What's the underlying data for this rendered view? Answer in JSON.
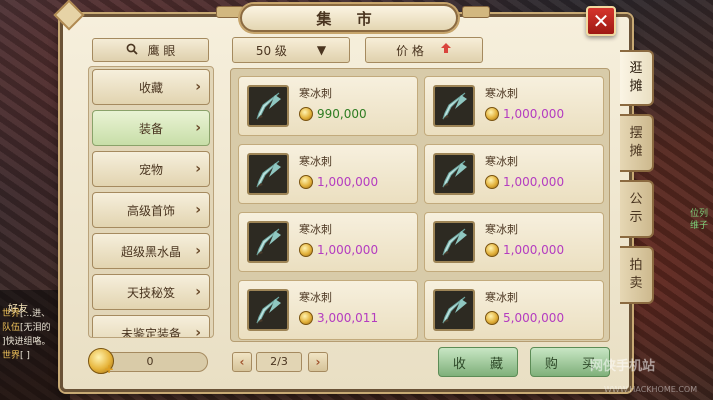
{
  "window": {
    "title": "集 市",
    "close_label": "✕"
  },
  "search": {
    "label": "鹰 眼"
  },
  "categories": [
    {
      "label": "收藏"
    },
    {
      "label": "装备",
      "active": true
    },
    {
      "label": "宠物"
    },
    {
      "label": "高级首饰"
    },
    {
      "label": "超级黑水晶"
    },
    {
      "label": "天技秘笈"
    },
    {
      "label": "未鉴定装备"
    }
  ],
  "filters": {
    "level_label": "50 级",
    "level_caret": "▼",
    "price_label": "价 格",
    "price_sort_icon": "arrow-up-icon"
  },
  "items": [
    {
      "name": "寒冰刺",
      "price": "990,000",
      "price_color": "#2e7d22"
    },
    {
      "name": "寒冰刺",
      "price": "1,000,000",
      "price_color": "#b43cc0"
    },
    {
      "name": "寒冰刺",
      "price": "1,000,000",
      "price_color": "#b43cc0"
    },
    {
      "name": "寒冰刺",
      "price": "1,000,000",
      "price_color": "#b43cc0"
    },
    {
      "name": "寒冰刺",
      "price": "1,000,000",
      "price_color": "#b43cc0"
    },
    {
      "name": "寒冰刺",
      "price": "1,000,000",
      "price_color": "#b43cc0"
    },
    {
      "name": "寒冰刺",
      "price": "3,000,011",
      "price_color": "#b43cc0"
    },
    {
      "name": "寒冰刺",
      "price": "5,000,000",
      "price_color": "#b43cc0"
    }
  ],
  "currency": {
    "value": "0"
  },
  "pagination": {
    "prev": "‹",
    "indicator": "2/3",
    "next": "›"
  },
  "actions": {
    "favorite": "收 藏",
    "buy": "购 买"
  },
  "side_tabs": [
    {
      "label": "逛摊",
      "active": true
    },
    {
      "label": "摆摊"
    },
    {
      "label": "公示"
    },
    {
      "label": "拍卖"
    }
  ],
  "chat": {
    "friend_label": "好友",
    "lines": [
      {
        "tag": "世界",
        "text": "[...进、"
      },
      {
        "tag": "队伍",
        "text": "[无泪的"
      },
      {
        "tag": "",
        "text": "]快进组咯。"
      },
      {
        "tag": "世界",
        "text": "[ ]"
      }
    ]
  },
  "right_overlay_text": "位列 维子",
  "watermark": {
    "main": "网侠手机站",
    "sub": "WWW.HACKHOME.COM"
  }
}
